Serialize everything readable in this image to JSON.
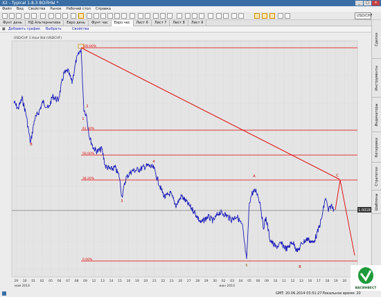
{
  "window": {
    "title": "X2 - Typical 1.8.3 ВОЛНЫ *"
  },
  "menu": [
    "Файл",
    "Вид",
    "Свойства",
    "Рынок",
    "Рабочий стол",
    "Справка"
  ],
  "symbol": "USD/CHF",
  "tabs": [
    "Фунт день",
    "НД Альтернатива",
    "Евро день",
    "Фунт час",
    "Евро час",
    "Лист 6",
    "Лист 7",
    "Лист 8",
    "Лист 9"
  ],
  "active_tab": 4,
  "chart_toolbar": {
    "add": "Добавить график",
    "select": "Выбрать",
    "props": "Свойства"
  },
  "chart_header": "USD/CHF 1 Hour Bid (USDCHF)",
  "right_tabs": [
    "Сделки",
    "Инструменты",
    "Индикаторы",
    "Котировки",
    "Стратегии",
    "Шаблоны"
  ],
  "fib_labels": [
    "100.00%",
    "61.80%",
    "50.00%",
    "38.20%",
    "0.00%"
  ],
  "wave_labels": [
    "1",
    "2",
    "3",
    "4",
    "5",
    "A",
    "B",
    "C"
  ],
  "price_label": "1.0018",
  "xaxis_ticks": [
    "29",
    "30",
    "01",
    "02",
    "05",
    "06",
    "07",
    "08",
    "09",
    "12",
    "13",
    "14",
    "15",
    "16",
    "19",
    "20",
    "21",
    "22",
    "23",
    "26",
    "27",
    "28",
    "29",
    "30",
    "02",
    "03",
    "04",
    "05",
    "06",
    "09",
    "10",
    "11",
    "12",
    "13",
    "16",
    "17",
    "18",
    "19",
    "20",
    "23"
  ],
  "xaxis_months": [
    "май 2014",
    "июн 2014"
  ],
  "status": {
    "time": "GMT: 20.06.2014 03:51:27",
    "local": "Локальное время: 20"
  },
  "logo": "ВАСИНВЕСТ",
  "colors": {
    "price": "#1a1ab8",
    "fib": "#e00000",
    "trend": "#e00000",
    "title": "#3a6ea5"
  }
}
